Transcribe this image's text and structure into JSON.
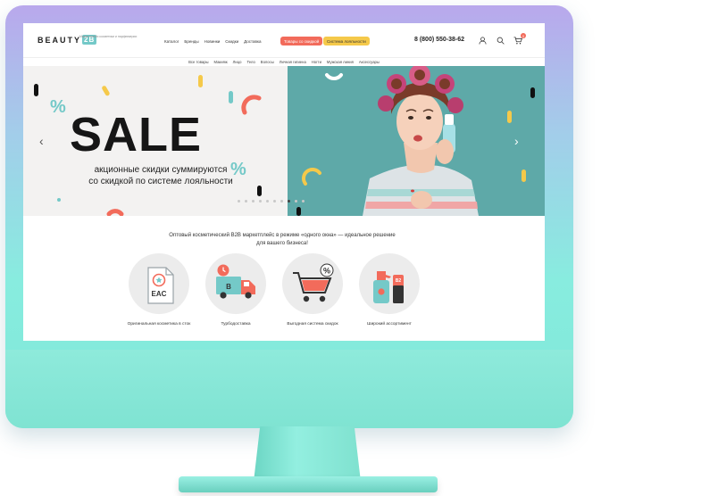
{
  "logo": {
    "brand": "BEAUTY",
    "badge": "2B",
    "tagline": "Маркетплейс косметики и парфюмерии"
  },
  "topnav": {
    "items": [
      "Каталог",
      "Бренды",
      "Новинки",
      "Скидки",
      "Доставка"
    ],
    "sale_pill": "Товары со скидкой",
    "loyalty_pill": "Система лояльности"
  },
  "phone": "8 (800) 550-38-62",
  "cart": {
    "count": "0"
  },
  "categories": [
    "Все товары",
    "Макияж",
    "Лицо",
    "Тело",
    "Волосы",
    "Личная гигиена",
    "Ногти",
    "Мужская линия",
    "Аксессуары"
  ],
  "hero": {
    "title": "SALE",
    "subtitle_line1": "акционные скидки суммируются",
    "subtitle_line2": "со скидкой по системе лояльности",
    "prev": "‹",
    "next": "›",
    "slide_count": 10,
    "active_slide": 7
  },
  "info": {
    "line1": "Оптовый косметический B2B маркетплейс в режиме «одного окна» — идеальное решение",
    "line2": "для вашего бизнеса!"
  },
  "features": [
    {
      "label": "Оригинальная косметика в сток",
      "icon": "certificate-icon"
    },
    {
      "label": "Турбодоставка",
      "icon": "delivery-truck-icon"
    },
    {
      "label": "Выгодная система скидок",
      "icon": "discount-cart-icon"
    },
    {
      "label": "Широкий ассортимент",
      "icon": "cosmetics-bottles-icon"
    }
  ],
  "colors": {
    "accent_teal": "#74c9c8",
    "accent_coral": "#f26b5b",
    "accent_yellow": "#f5c94a",
    "hero_bg": "#5ea9a8"
  }
}
